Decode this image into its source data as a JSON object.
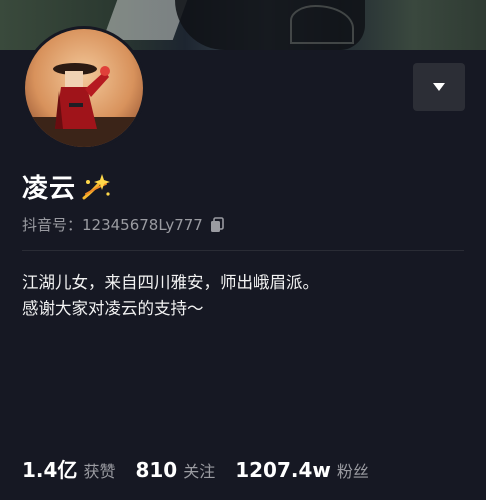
{
  "profile": {
    "name": "凌云",
    "id_label": "抖音号：12345678Ly777",
    "bio": [
      "江湖儿女，来自四川雅安，师出峨眉派。",
      "感谢大家对凌云的支持～"
    ]
  },
  "stats": [
    {
      "value": "1.4亿",
      "label": "获赞"
    },
    {
      "value": "810",
      "label": "关注"
    },
    {
      "value": "1207.4w",
      "label": "粉丝"
    }
  ],
  "icons": {
    "name_badge": "sparkle-icon",
    "copy": "copy-icon",
    "menu": "chevron-down-icon"
  }
}
